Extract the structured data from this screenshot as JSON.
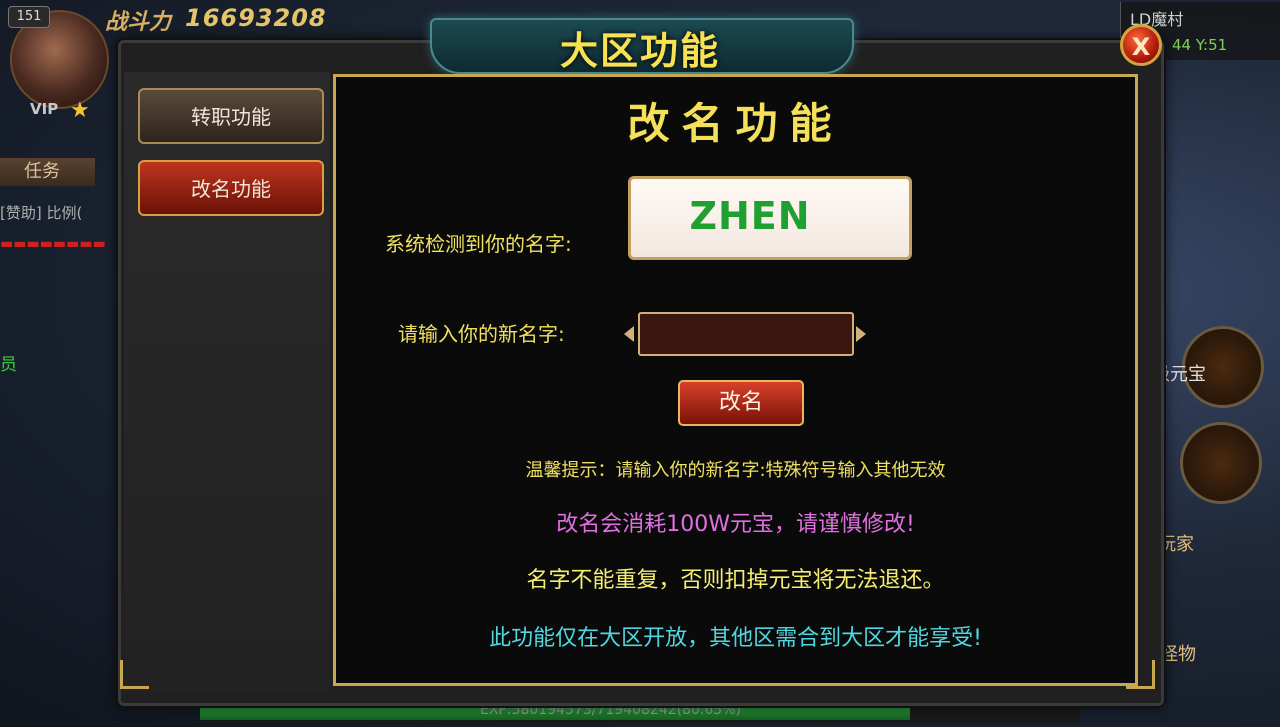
{
  "hud": {
    "level": "151",
    "vip_label": "VIP",
    "power_label": "战斗力",
    "power_value": "16693208",
    "map_name": "LD魔村",
    "coords": "44 Y:51",
    "task_tab": "任务",
    "sponsor_line": "[赞助] 比例(",
    "member_fragment": "员",
    "yuanbao_fragment": "级元宝",
    "player_fragment": "玩家",
    "monster_fragment": "怪物",
    "exp_text": "EXP:580194573/719408242(80.65%)",
    "exp_fraction": 0.8065
  },
  "dialog": {
    "title": "大区功能",
    "close_label": "X",
    "side_buttons": [
      {
        "label": "转职功能",
        "active": false
      },
      {
        "label": "改名功能",
        "active": true
      }
    ],
    "panel_title": "改名功能",
    "current_name_label": "系统检测到你的名字:",
    "current_name": "ZHEN",
    "new_name_label": "请输入你的新名字:",
    "new_name_value": "",
    "rename_button": "改名",
    "tips": [
      "温馨提示：请输入你的新名字:特殊符号输入其他无效",
      "改名会消耗100W元宝，请谨慎修改!",
      "名字不能重复，否则扣掉元宝将无法退还。",
      "此功能仅在大区开放，其他区需合到大区才能享受!"
    ]
  },
  "colors": {
    "accent_gold": "#c8a84e",
    "title_yellow": "#f8e252",
    "name_green": "#20a030",
    "warning_pink": "#e070e0",
    "info_cyan": "#50d8e0"
  }
}
